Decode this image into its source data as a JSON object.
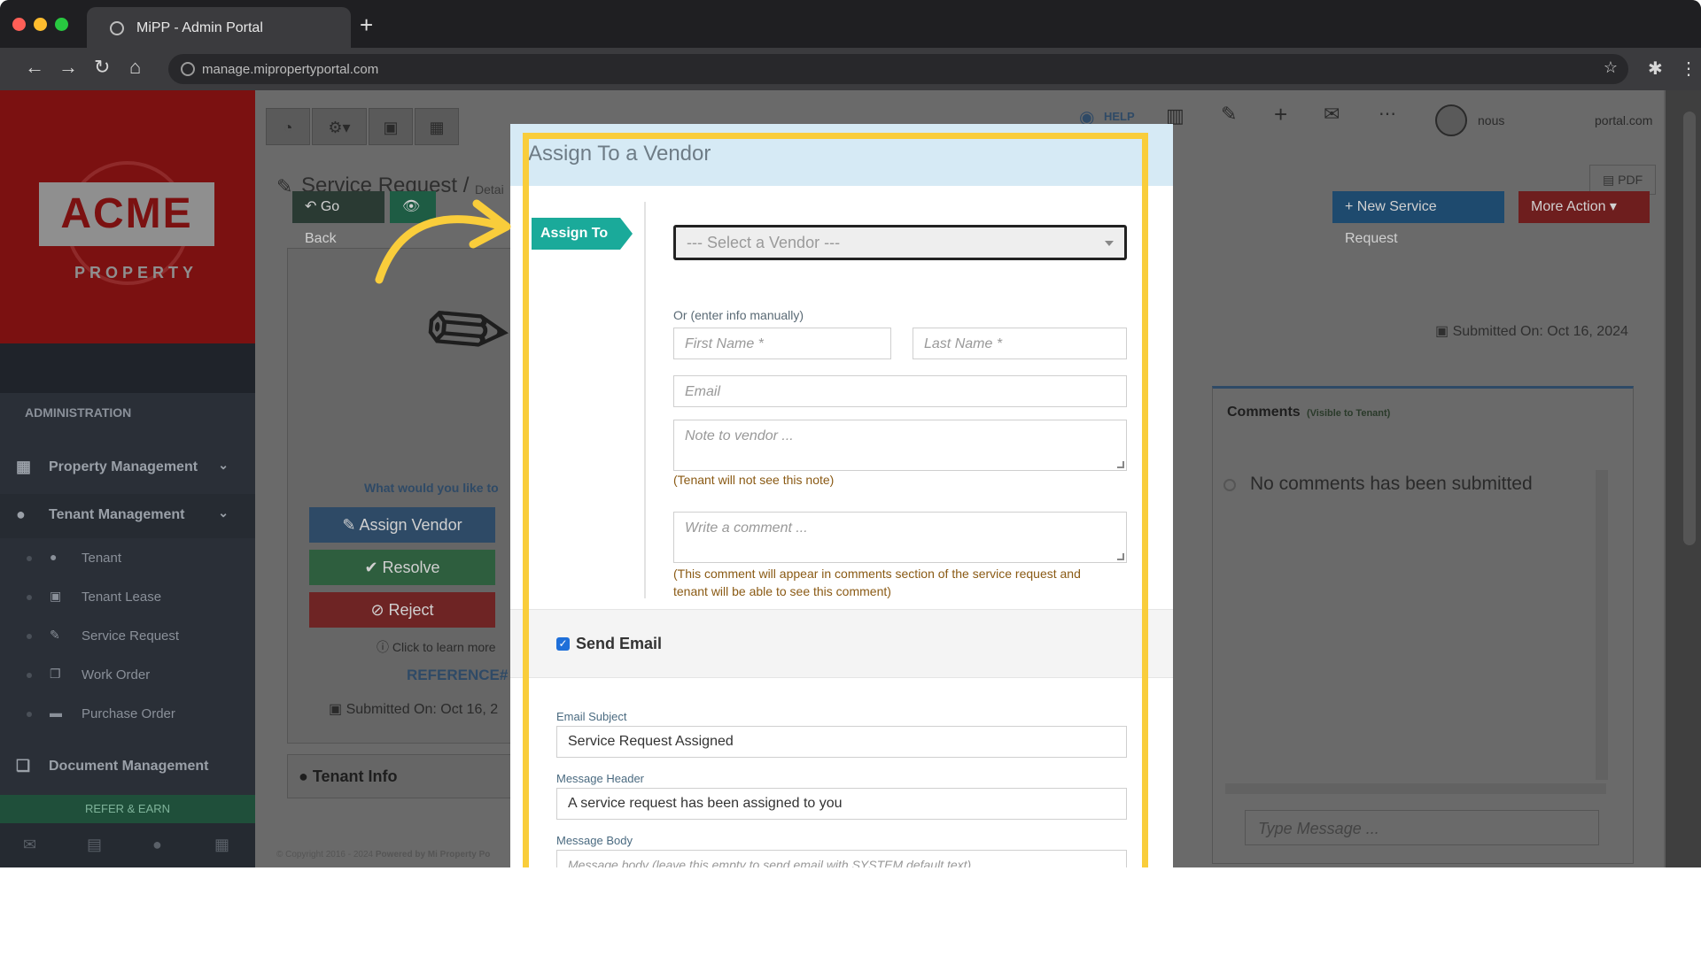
{
  "browser": {
    "tab_title": "MiPP - Admin Portal",
    "url": "manage.mipropertyportal.com"
  },
  "colors": {
    "highlight": "#f9cd3b",
    "assign_tag": "#1aaa9a",
    "modal_header": "#d6eaf5"
  },
  "sidebar": {
    "logo_text": "ACME",
    "logo_sub": "PROPERTY",
    "section_title": "ADMINISTRATION",
    "items": [
      {
        "label": "Property Management",
        "icon": "building-icon"
      },
      {
        "label": "Tenant Management",
        "icon": "users-icon"
      },
      {
        "label": "Document Management",
        "icon": "documents-icon"
      }
    ],
    "sub_items": [
      {
        "label": "Tenant",
        "icon": "user-icon"
      },
      {
        "label": "Tenant Lease",
        "icon": "calendar-icon"
      },
      {
        "label": "Service Request",
        "icon": "wrench-icon"
      },
      {
        "label": "Work Order",
        "icon": "copy-icon"
      },
      {
        "label": "Purchase Order",
        "icon": "truck-icon"
      }
    ],
    "refer": "REFER & EARN"
  },
  "header": {
    "help": "HELP",
    "user": "nous",
    "user_suffix": "portal.com"
  },
  "page": {
    "title": "Service Request /",
    "title_sub": "Detai",
    "go_back": "Go Back",
    "pdf": "PDF",
    "new_request": "New Service Request",
    "more_action": "More Action",
    "submitted_on": "Submitted On: Oct 16, 2024",
    "question": "What would you like to",
    "assign_vendor": "Assign Vendor",
    "resolve": "Resolve",
    "reject": "Reject",
    "learn_more": "Click to learn more",
    "reference": "REFERENCE#",
    "submitted_short": "Submitted On: Oct 16, 2",
    "tenant_info": "Tenant Info",
    "comments_title": "Comments",
    "comments_visible": "(Visible to Tenant)",
    "no_comments": "No comments has been submitted",
    "type_message_placeholder": "Type Message ...",
    "copyright": "© Copyright 2016 - 2024",
    "powered_by": "Powered by Mi Property Po"
  },
  "modal": {
    "title": "Assign To a Vendor",
    "assign_to": "Assign To",
    "select_vendor": "--- Select a Vendor ---",
    "manual_label": "Or (enter info manually)",
    "first_name_ph": "First Name *",
    "last_name_ph": "Last Name *",
    "email_ph": "Email",
    "note_ph": "Note to vendor ...",
    "note_hint": "(Tenant will not see this note)",
    "comment_ph": "Write a comment ...",
    "comment_hint_1": "(This comment will appear in comments section of the service request and",
    "comment_hint_2": "tenant will be able to see this comment)",
    "send_email": "Send Email",
    "email_subject_label": "Email Subject",
    "email_subject_value": "Service Request Assigned",
    "message_header_label": "Message Header",
    "message_header_value": "A service request has been assigned to you",
    "message_body_label": "Message Body",
    "message_body_ph": "Message body (leave this empty to send email with SYSTEM default text)"
  }
}
